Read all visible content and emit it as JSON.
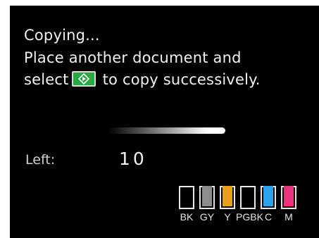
{
  "screen": {
    "message_line1": "Copying...",
    "message_line2": "Place another document and",
    "message_line3_before": "select",
    "message_line3_after": "to copy successively.",
    "start_icon": "color-start-icon",
    "progress_fraction": 0.85
  },
  "remaining": {
    "label": "Left:",
    "value": "10"
  },
  "inks": [
    {
      "label": "BK",
      "color": "#000000",
      "level": 0
    },
    {
      "label": "GY",
      "color": "#8c8c8c",
      "level": 1
    },
    {
      "label": "Y",
      "color": "#e6a21a",
      "level": 1
    },
    {
      "label": "PGBK",
      "color": "#000000",
      "level": 0
    },
    {
      "label": "C",
      "color": "#2ea3ea",
      "level": 1
    },
    {
      "label": "M",
      "color": "#e8347d",
      "level": 1
    }
  ]
}
